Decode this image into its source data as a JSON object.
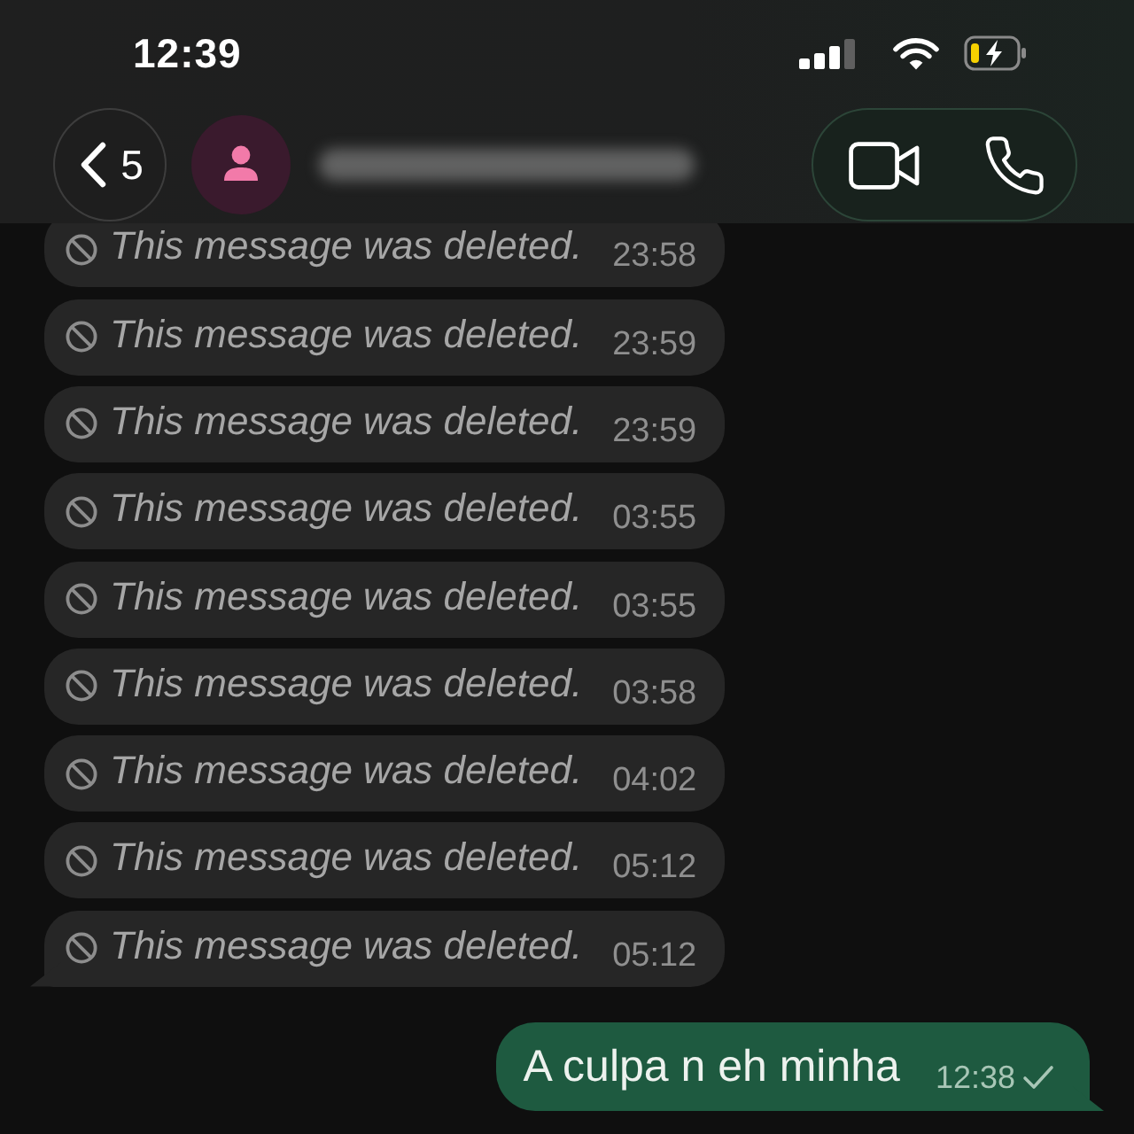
{
  "status_bar": {
    "time": "12:39"
  },
  "header": {
    "back_count": "5"
  },
  "messages": [
    {
      "kind": "deleted",
      "text": "This message was deleted.",
      "time": "23:58",
      "tail": false
    },
    {
      "kind": "deleted",
      "text": "This message was deleted.",
      "time": "23:59",
      "tail": false
    },
    {
      "kind": "deleted",
      "text": "This message was deleted.",
      "time": "23:59",
      "tail": false
    },
    {
      "kind": "deleted",
      "text": "This message was deleted.",
      "time": "03:55",
      "tail": false
    },
    {
      "kind": "deleted",
      "text": "This message was deleted.",
      "time": "03:55",
      "tail": false
    },
    {
      "kind": "deleted",
      "text": "This message was deleted.",
      "time": "03:58",
      "tail": false
    },
    {
      "kind": "deleted",
      "text": "This message was deleted.",
      "time": "04:02",
      "tail": false
    },
    {
      "kind": "deleted",
      "text": "This message was deleted.",
      "time": "05:12",
      "tail": false
    },
    {
      "kind": "deleted",
      "text": "This message was deleted.",
      "time": "05:12",
      "tail": true
    },
    {
      "kind": "outgoing",
      "text": "A culpa n eh minha",
      "time": "12:38",
      "delivered": false,
      "tail": true
    }
  ]
}
